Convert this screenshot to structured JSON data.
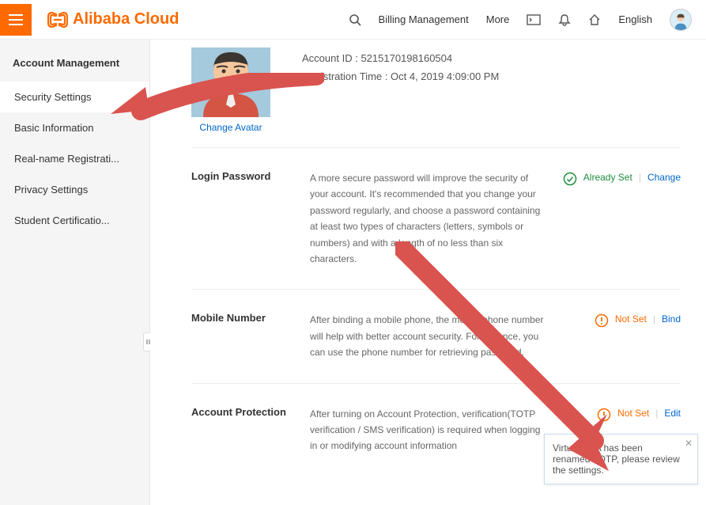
{
  "header": {
    "brand": "Alibaba Cloud",
    "billing": "Billing Management",
    "more": "More",
    "language": "English"
  },
  "sidebar": {
    "title": "Account Management",
    "items": [
      {
        "label": "Security Settings",
        "active": true
      },
      {
        "label": "Basic Information"
      },
      {
        "label": "Real-name Registrati..."
      },
      {
        "label": "Privacy Settings"
      },
      {
        "label": "Student Certificatio..."
      }
    ]
  },
  "profile": {
    "account_id_label": "Account ID :",
    "account_id": "5215170198160504",
    "registration_label": "Registration Time :",
    "registration_time": "Oct 4, 2019 4:09:00 PM",
    "change_avatar": "Change Avatar"
  },
  "sections": {
    "password": {
      "title": "Login Password",
      "desc": "A more secure password will improve the security of your account. It's recommended that you change your password regularly, and choose a password containing at least two types of characters (letters, symbols or numbers) and with a length of no less than six characters.",
      "status": "Already Set",
      "action": "Change"
    },
    "mobile": {
      "title": "Mobile Number",
      "desc": "After binding a mobile phone, the mobile phone number will help with better account security. For instance, you can use the phone number for retrieving password.",
      "status": "Not Set",
      "action": "Bind"
    },
    "protection": {
      "title": "Account Protection",
      "desc": "After turning on Account Protection, verification(TOTP verification / SMS verification) is required when logging in or modifying account information",
      "status": "Not Set",
      "action": "Edit"
    }
  },
  "tooltip": {
    "text": "Virtual MFA has been renamed TOTP, please review the settings."
  }
}
